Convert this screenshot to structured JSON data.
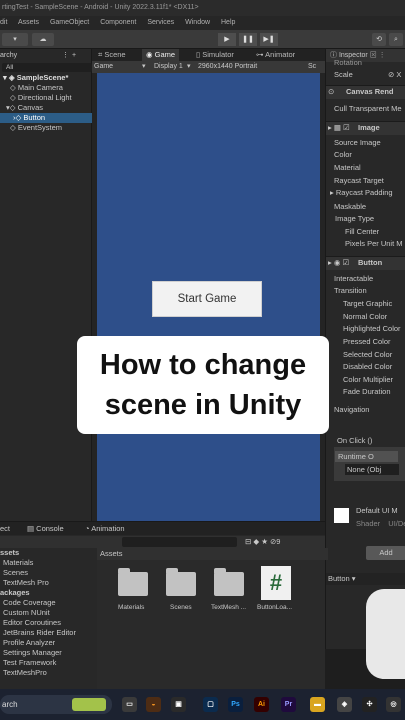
{
  "titlebar": {
    "text": "rtingTest - SampleScene - Android - Unity 2022.3.11f1* <DX11>"
  },
  "menu": [
    "dit",
    "Assets",
    "GameObject",
    "Component",
    "Services",
    "Window",
    "Help"
  ],
  "toolbar": {
    "cloud_icon": "cloud-icon",
    "gear_icon": "gear-icon"
  },
  "hierarchy": {
    "tab": "archy",
    "search": "All",
    "items": [
      {
        "label": "SampleScene*"
      },
      {
        "label": "Main Camera"
      },
      {
        "label": "Directional Light"
      },
      {
        "label": "Canvas"
      },
      {
        "label": "Button"
      },
      {
        "label": "EventSystem"
      }
    ]
  },
  "game": {
    "tabs": [
      "Scene",
      "Game",
      "Simulator",
      "Animator"
    ],
    "options": {
      "mode": "Game",
      "display": "Display 1",
      "resolution": "2960x1440 Portrait",
      "scale": "Sc"
    },
    "start_button": "Start Game"
  },
  "inspector": {
    "tab": "Inspector",
    "rows_top": [
      "Rotation",
      "Scale"
    ],
    "canvas_renderer": "Canvas Rend",
    "cull": "Cull Transparent Me",
    "image_header": "Image",
    "image_fields": [
      "Source Image",
      "Color",
      "Material",
      "Raycast Target",
      "Raycast Padding",
      "Maskable",
      "Image Type",
      "Fill Center",
      "Pixels Per Unit M"
    ],
    "button_header": "Button",
    "button_fields": [
      "Interactable",
      "Transition",
      "Target Graphic",
      "Normal Color",
      "Highlighted Color",
      "Pressed Color",
      "Selected Color",
      "Disabled Color",
      "Color Multiplier",
      "Fade Duration"
    ],
    "navigation": "Navigation",
    "onclick": "On Click ()",
    "runtime": "Runtime O",
    "none": "None (Obj",
    "material": "Default UI M",
    "shader": "Shader",
    "shader_val": "UI/De",
    "add": "Add",
    "button_preview": "Button"
  },
  "bottom": {
    "tabs": [
      "ect",
      "Console",
      "Animation"
    ],
    "project_items": [
      "ssets",
      "Materials",
      "Scenes",
      "TextMesh Pro",
      "ackages",
      "Code Coverage",
      "Custom NUnit",
      "Editor Coroutines",
      "JetBrains Rider Editor",
      "Profile Analyzer",
      "Settings Manager",
      "Test Framework",
      "TextMeshPro"
    ],
    "assets_header": "Assets",
    "assets": [
      {
        "label": "Materials",
        "kind": "folder"
      },
      {
        "label": "Scenes",
        "kind": "folder"
      },
      {
        "label": "TextMesh ...",
        "kind": "folder"
      },
      {
        "label": "ButtonLoa...",
        "kind": "script"
      }
    ]
  },
  "overlay": {
    "line1": "How to change",
    "line2": "scene in Unity"
  },
  "taskbar": {
    "search": "arch",
    "apps": [
      "Ps",
      "Ai",
      "Pr"
    ]
  }
}
